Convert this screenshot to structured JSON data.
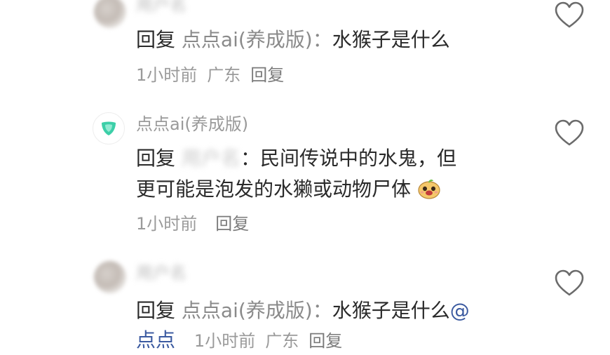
{
  "comments": [
    {
      "username": "用户名",
      "reply_word": "回复",
      "reply_to": "点点ai(养成版)",
      "separator": "：",
      "text": "水猴子是什么",
      "time": "1小时前",
      "location": "广东",
      "reply_label": "回复"
    },
    {
      "username": "点点ai(养成版)",
      "reply_word": "回复",
      "reply_to": "用户名",
      "separator": "：",
      "text_line1": "民间传说中的水鬼，但",
      "text_line2": "更可能是泡发的水獭或动物尸体",
      "emoji_icon": "smiling-face-sticker-icon",
      "time": "1小时前",
      "reply_label": "回复"
    },
    {
      "username": "用户名",
      "reply_word": "回复",
      "reply_to": "点点ai(养成版)",
      "separator": "：",
      "text": "水猴子是什么",
      "at_text": "@",
      "continuation": "点点",
      "time": "1小时前",
      "location": "广东",
      "reply_label": "回复"
    }
  ],
  "icons": {
    "like": "heart-outline-icon",
    "bot_avatar": "shield-logo-icon"
  },
  "colors": {
    "heart_stroke": "#6b6b6b",
    "meta_text": "#9a9a9a",
    "main_text": "#2a2a2a",
    "bot_logo": "#3ccfa8"
  }
}
